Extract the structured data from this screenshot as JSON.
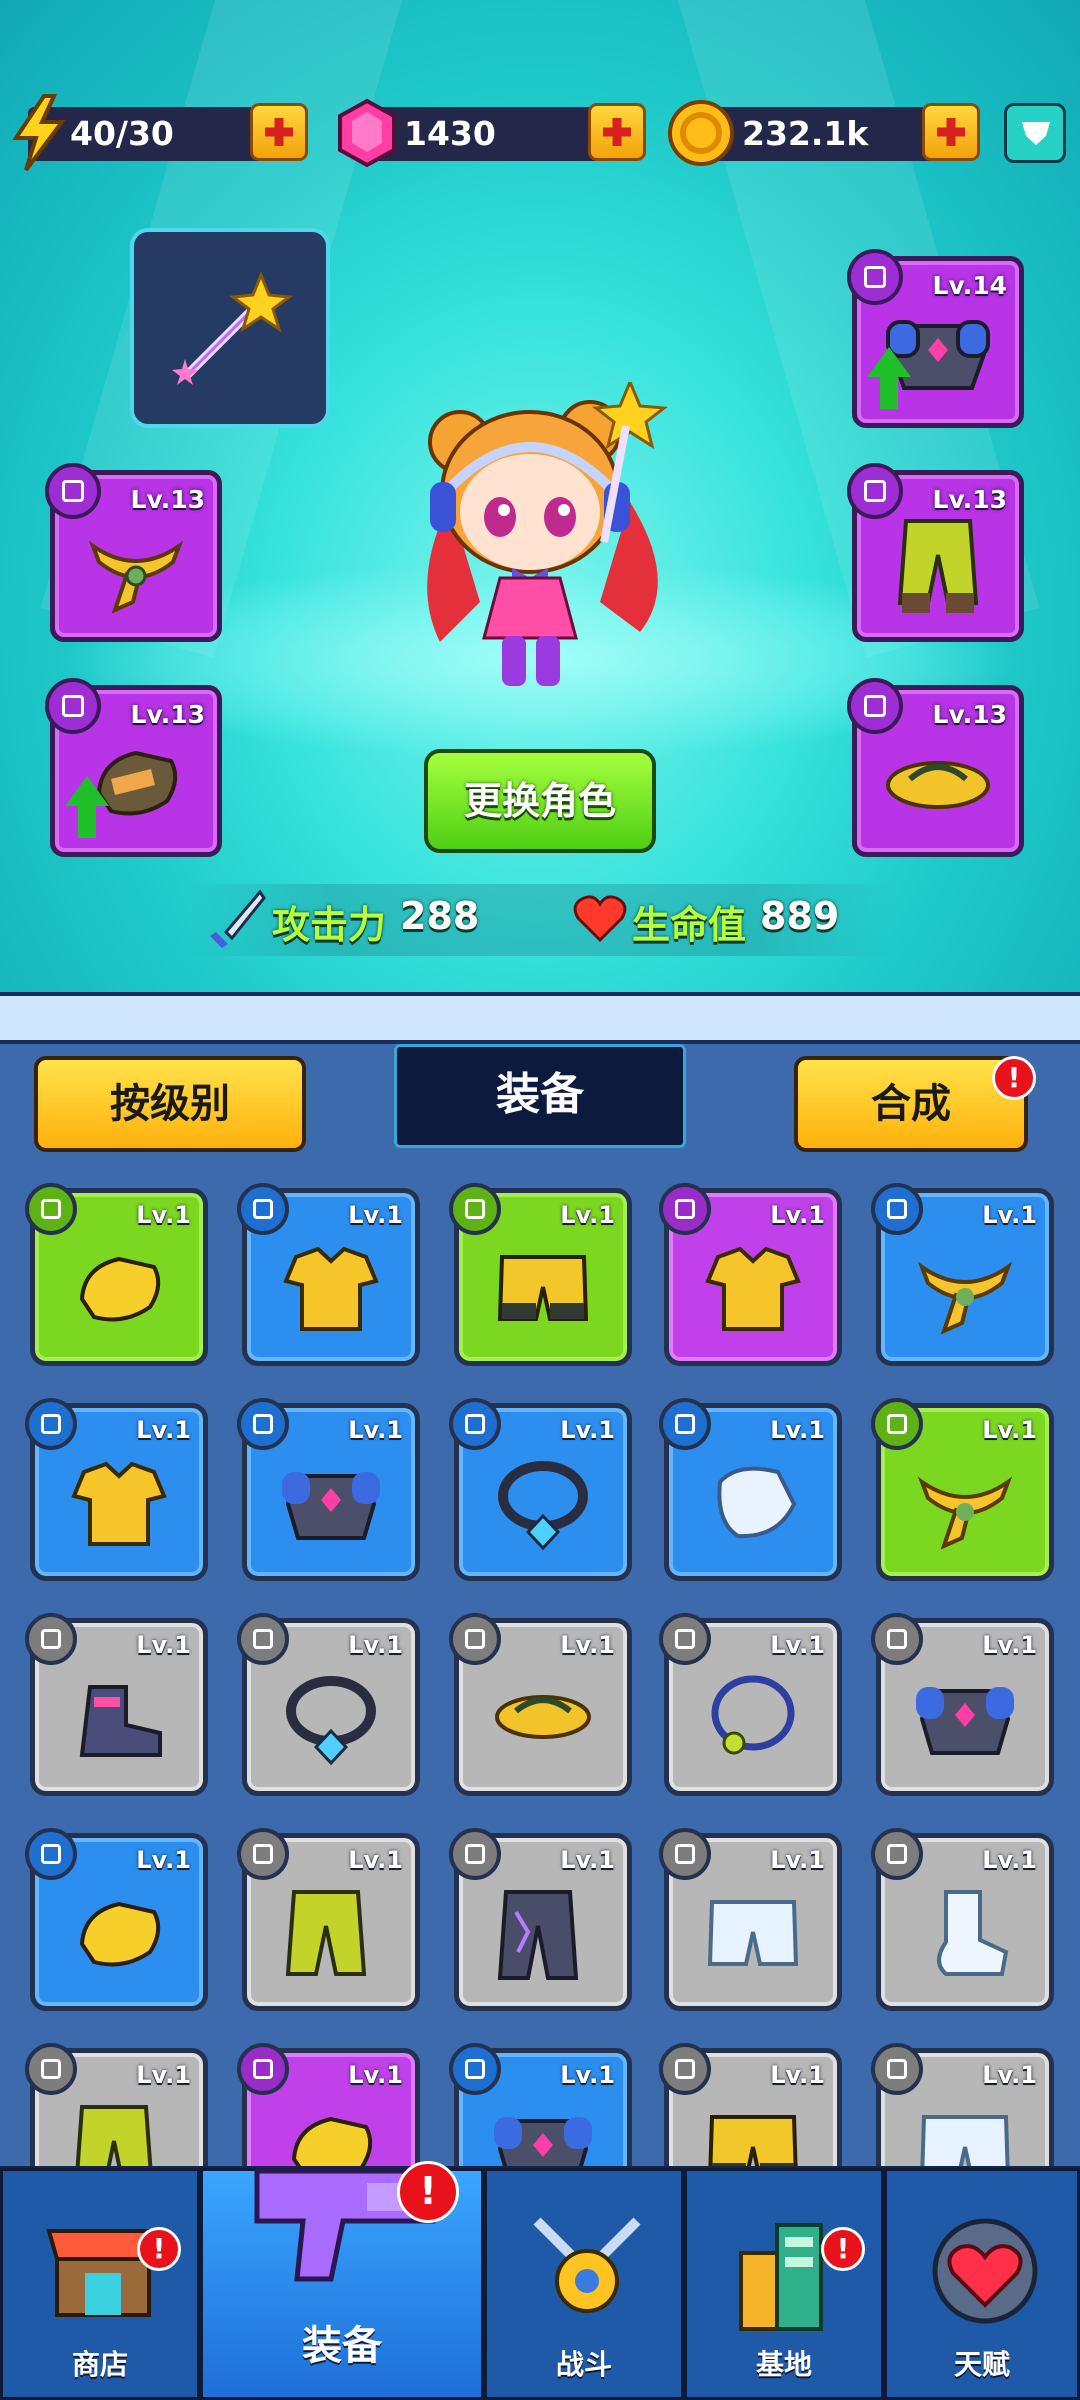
{
  "resources": {
    "energy": "40/30",
    "gems": "1430",
    "coins": "232.1k"
  },
  "equipped": {
    "weapon": {
      "name": "magic-wand"
    },
    "slots": [
      {
        "id": "necklace",
        "level": "Lv.13",
        "upgrade": false
      },
      {
        "id": "gloves",
        "level": "Lv.13",
        "upgrade": true
      },
      {
        "id": "armor",
        "level": "Lv.14",
        "upgrade": true
      },
      {
        "id": "pants",
        "level": "Lv.13",
        "upgrade": false
      },
      {
        "id": "shoes",
        "level": "Lv.13",
        "upgrade": false
      }
    ]
  },
  "character": {
    "change_label": "更换角色",
    "attack_label": "攻击力",
    "attack_value": "288",
    "hp_label": "生命值",
    "hp_value": "889"
  },
  "inventory_header": {
    "sort_label": "按级别",
    "title": "装备",
    "merge_label": "合成",
    "merge_alert": "!"
  },
  "inventory": [
    {
      "rarity": "green",
      "type": "gloves",
      "level": "Lv.1"
    },
    {
      "rarity": "blue",
      "type": "shirt",
      "level": "Lv.1"
    },
    {
      "rarity": "green",
      "type": "shorts",
      "level": "Lv.1"
    },
    {
      "rarity": "purple",
      "type": "shirt",
      "level": "Lv.1"
    },
    {
      "rarity": "blue",
      "type": "scarf",
      "level": "Lv.1"
    },
    {
      "rarity": "blue",
      "type": "shirt",
      "level": "Lv.1"
    },
    {
      "rarity": "blue",
      "type": "armor",
      "level": "Lv.1"
    },
    {
      "rarity": "blue",
      "type": "necklace",
      "level": "Lv.1"
    },
    {
      "rarity": "blue",
      "type": "glove",
      "level": "Lv.1"
    },
    {
      "rarity": "green",
      "type": "scarf",
      "level": "Lv.1"
    },
    {
      "rarity": "gray",
      "type": "boots",
      "level": "Lv.1"
    },
    {
      "rarity": "gray",
      "type": "necklace",
      "level": "Lv.1"
    },
    {
      "rarity": "gray",
      "type": "sandals",
      "level": "Lv.1"
    },
    {
      "rarity": "gray",
      "type": "ring-necklace",
      "level": "Lv.1"
    },
    {
      "rarity": "gray",
      "type": "armor",
      "level": "Lv.1"
    },
    {
      "rarity": "blue",
      "type": "gloves",
      "level": "Lv.1"
    },
    {
      "rarity": "gray",
      "type": "pants",
      "level": "Lv.1"
    },
    {
      "rarity": "gray",
      "type": "pants-dark",
      "level": "Lv.1"
    },
    {
      "rarity": "gray",
      "type": "shorts-white",
      "level": "Lv.1"
    },
    {
      "rarity": "gray",
      "type": "sock",
      "level": "Lv.1"
    },
    {
      "rarity": "gray",
      "type": "pants",
      "level": "Lv.1"
    },
    {
      "rarity": "purple",
      "type": "gloves",
      "level": "Lv.1"
    },
    {
      "rarity": "blue",
      "type": "armor",
      "level": "Lv.1"
    },
    {
      "rarity": "gray",
      "type": "shorts",
      "level": "Lv.1"
    },
    {
      "rarity": "gray",
      "type": "shorts-white",
      "level": "Lv.1"
    }
  ],
  "nav": [
    {
      "label": "商店",
      "icon": "shop-icon",
      "alert": "!"
    },
    {
      "label": "装备",
      "icon": "gun-icon",
      "alert": "!"
    },
    {
      "label": "战斗",
      "icon": "battle-icon",
      "alert": ""
    },
    {
      "label": "基地",
      "icon": "base-icon",
      "alert": "!"
    },
    {
      "label": "天赋",
      "icon": "heart-shield-icon",
      "alert": ""
    }
  ],
  "colors": {
    "scene": "#37e3dc",
    "panel": "#3c6aad",
    "rarity_green": "#7bd71f",
    "rarity_blue": "#2c8ff0",
    "rarity_purple": "#c041ea",
    "rarity_gray": "#b7b7b7"
  }
}
